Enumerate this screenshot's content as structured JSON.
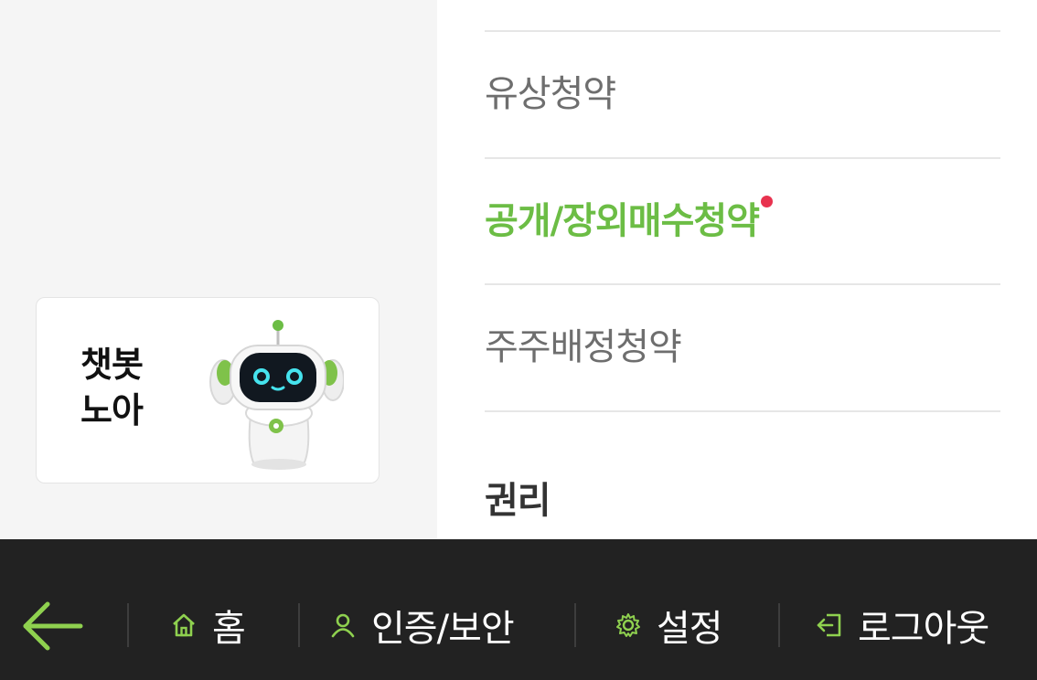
{
  "chatbot": {
    "line1": "챗봇",
    "line2": "노아"
  },
  "menu": {
    "items": [
      {
        "label": "유상청약",
        "active": false
      },
      {
        "label": "공개/장외매수청약",
        "active": true,
        "badge": "new-dot"
      },
      {
        "label": "주주배정청약",
        "active": false
      }
    ],
    "section_heading": "권리"
  },
  "bottom_nav": {
    "back_icon": "arrow-left-icon",
    "items": [
      {
        "label": "홈",
        "icon": "home-icon"
      },
      {
        "label": "인증/보안",
        "icon": "person-icon"
      },
      {
        "label": "설정",
        "icon": "gear-icon"
      },
      {
        "label": "로그아웃",
        "icon": "logout-icon"
      }
    ]
  },
  "colors": {
    "accent": "#6cbd45",
    "badge": "#e8324f",
    "bottom_bar": "#222222",
    "left_pane": "#f5f5f5"
  }
}
